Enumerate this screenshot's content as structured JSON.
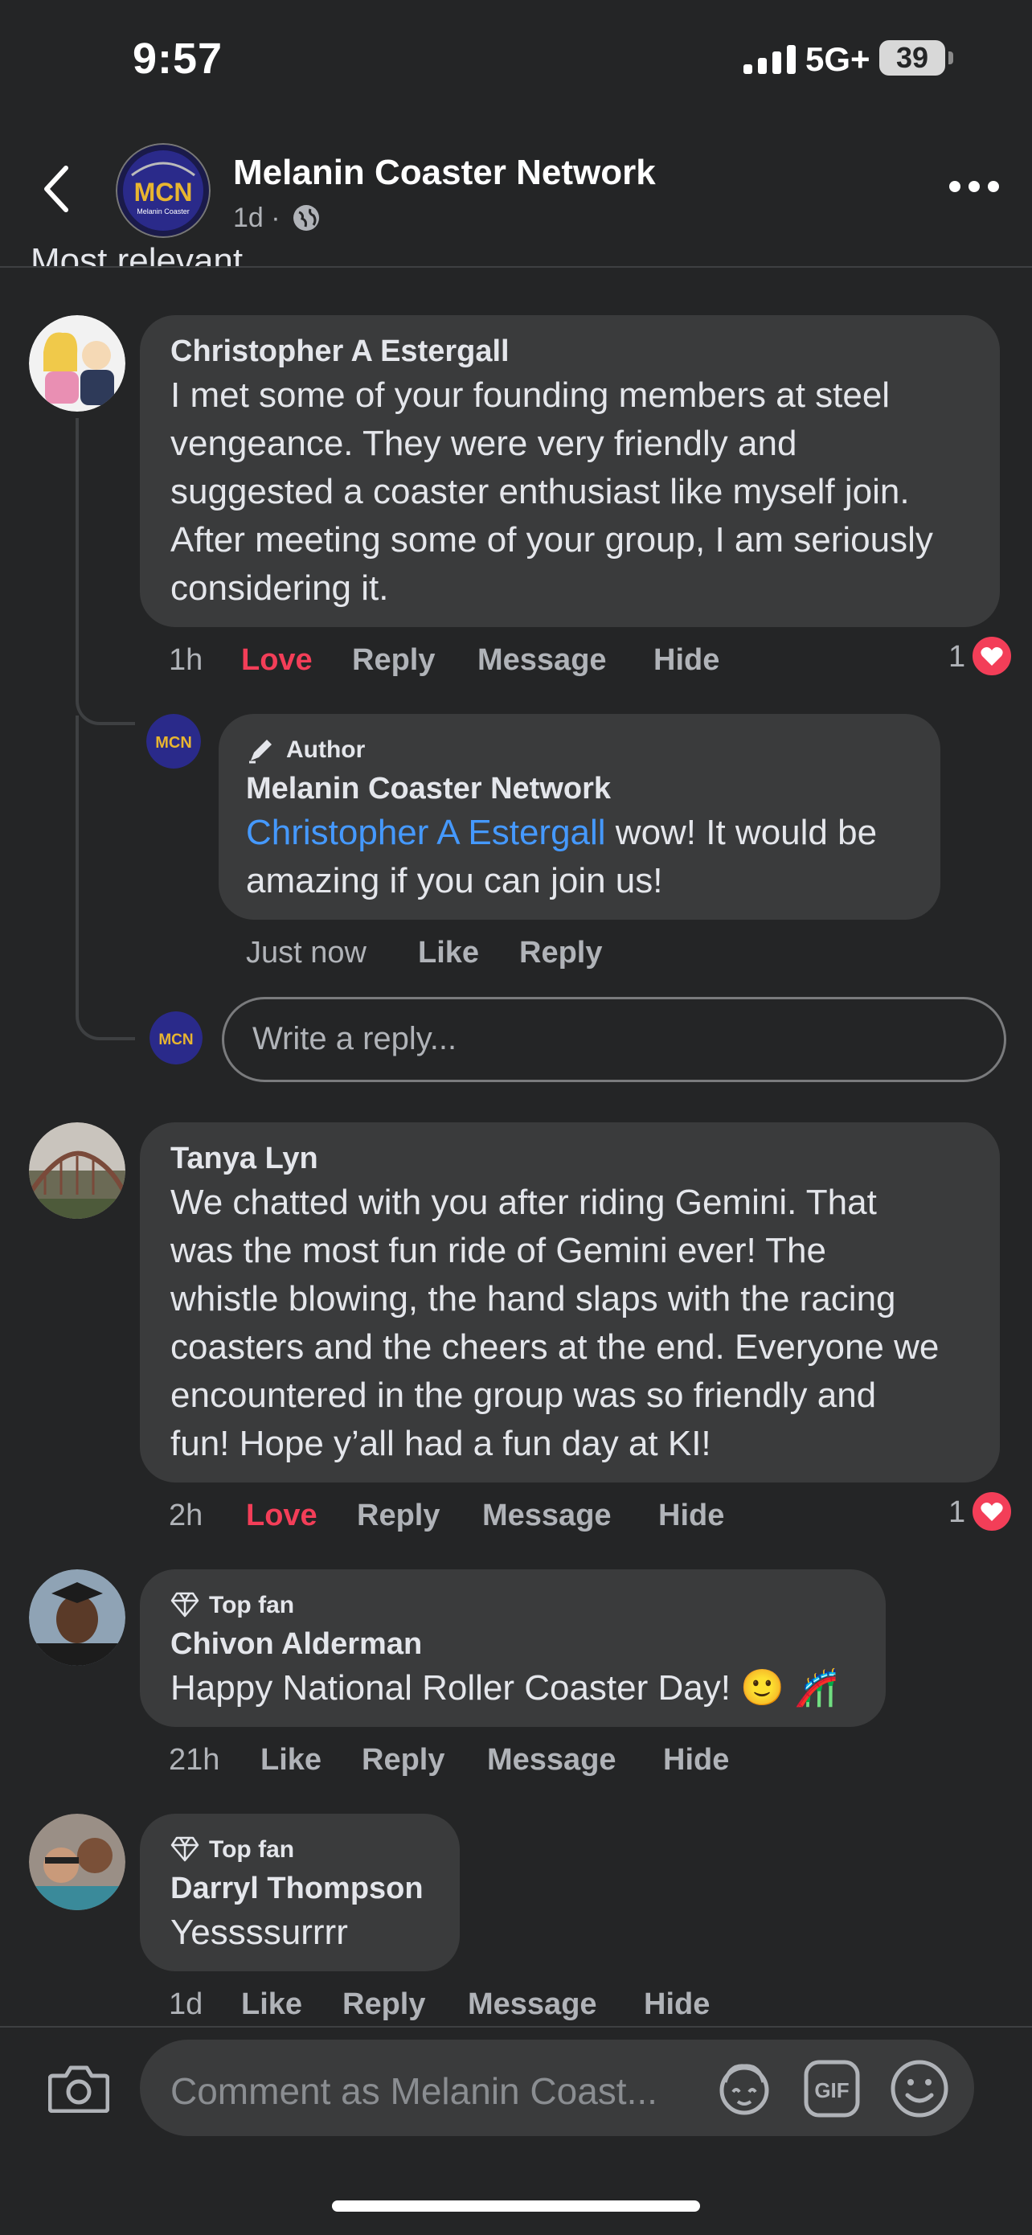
{
  "status_bar": {
    "time": "9:57",
    "network": "5G+",
    "battery": "39"
  },
  "header": {
    "page_name": "Melanin Coaster Network",
    "meta": "1d ·",
    "logo_text": "MCN",
    "cut_off_label": "Most relevant"
  },
  "comments": [
    {
      "name": "Christopher A Estergall",
      "lines": [
        "I met some of your founding members at steel",
        "vengeance. They were very friendly and",
        "suggested a coaster enthusiast like myself join.",
        "After meeting some of your group, I am seriously",
        "considering it."
      ],
      "time": "1h",
      "reaction": "Love",
      "reply": "Reply",
      "message": "Message",
      "hide": "Hide",
      "reaction_count": "1",
      "replies": [
        {
          "badge": "Author",
          "name": "Melanin Coaster Network",
          "mention": "Christopher A Estergall",
          "line1_rest": " wow! It would be",
          "line2": "amazing if you can join us!",
          "time": "Just now",
          "like": "Like",
          "reply": "Reply"
        }
      ],
      "reply_placeholder": "Write a reply..."
    },
    {
      "name": "Tanya Lyn",
      "lines": [
        "We chatted with you after riding Gemini.  That",
        "was the most fun ride of Gemini ever! The",
        "whistle blowing, the hand slaps with the racing",
        "coasters and the cheers at the end. Everyone we",
        "encountered in the group was so friendly and",
        "fun! Hope y’all had a fun day at KI!"
      ],
      "time": "2h",
      "reaction": "Love",
      "reply": "Reply",
      "message": "Message",
      "hide": "Hide",
      "reaction_count": "1"
    },
    {
      "badge": "Top fan",
      "name": "Chivon Alderman",
      "text": "Happy National Roller Coaster Day! 🙂 🎢",
      "time": "21h",
      "like": "Like",
      "reply": "Reply",
      "message": "Message",
      "hide": "Hide"
    },
    {
      "badge": "Top fan",
      "name": "Darryl Thompson",
      "text": "Yessssurrrr",
      "time": "1d",
      "like": "Like",
      "reply": "Reply",
      "message": "Message",
      "hide": "Hide"
    }
  ],
  "composer": {
    "placeholder": "Comment as Melanin Coast..."
  }
}
